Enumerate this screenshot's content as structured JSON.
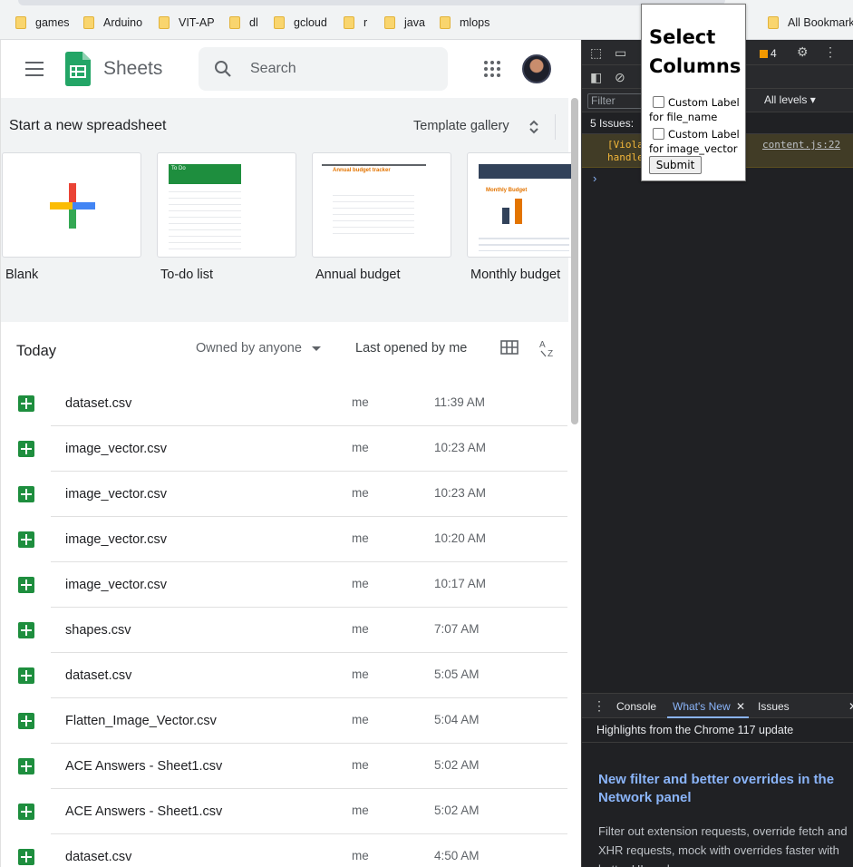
{
  "bookmarks": [
    "games",
    "Arduino",
    "VIT-AP",
    "dl",
    "gcloud",
    "r",
    "java",
    "mlops"
  ],
  "all_bookmarks": "All Bookmarks",
  "app": {
    "name": "Sheets",
    "search_placeholder": "Search"
  },
  "templates": {
    "heading": "Start a new spreadsheet",
    "gallery_label": "Template gallery",
    "items": [
      "Blank",
      "To-do list",
      "Annual budget",
      "Monthly budget"
    ],
    "todo_header": "To Do",
    "annual_header": "Annual budget tracker",
    "monthly_header": "Monthly Budget"
  },
  "filters": {
    "section_title": "Today",
    "owner_filter": "Owned by anyone",
    "sort_label": "Last opened by me"
  },
  "files": [
    {
      "name": "dataset.csv",
      "owner": "me",
      "time": "11:39 AM"
    },
    {
      "name": "image_vector.csv",
      "owner": "me",
      "time": "10:23 AM"
    },
    {
      "name": "image_vector.csv",
      "owner": "me",
      "time": "10:23 AM"
    },
    {
      "name": "image_vector.csv",
      "owner": "me",
      "time": "10:20 AM"
    },
    {
      "name": "image_vector.csv",
      "owner": "me",
      "time": "10:17 AM"
    },
    {
      "name": "shapes.csv",
      "owner": "me",
      "time": "7:07 AM"
    },
    {
      "name": "dataset.csv",
      "owner": "me",
      "time": "5:05 AM"
    },
    {
      "name": "Flatten_Image_Vector.csv",
      "owner": "me",
      "time": "5:04 AM"
    },
    {
      "name": "ACE Answers - Sheet1.csv",
      "owner": "me",
      "time": "5:02 AM"
    },
    {
      "name": "ACE Answers - Sheet1.csv",
      "owner": "me",
      "time": "5:02 AM"
    },
    {
      "name": "dataset.csv",
      "owner": "me",
      "time": "4:50 AM"
    }
  ],
  "devtools": {
    "issue_count_badge": "4",
    "filter_placeholder": "Filter",
    "levels": "All levels",
    "issues_text": "5 Issues:",
    "warning_line1": "[Viola",
    "warning_line2": "handle",
    "warning_source": "content.js:22",
    "prompt": "›",
    "drawer_tabs": [
      "Console",
      "What's New",
      "Issues"
    ],
    "highlights": "Highlights from the Chrome 117 update",
    "whats_new_title": "New filter and better overrides in the Network panel",
    "whats_new_body": "Filter out extension requests, override fetch and XHR requests, mock with overrides faster with better UI, and more."
  },
  "popup": {
    "title": "Select Columns",
    "options": [
      "Custom Label for file_name",
      "Custom Label for image_vector"
    ],
    "submit": "Submit"
  },
  "colors": {
    "sheets_green": "#1e8e3e",
    "devtools_bg": "#202124",
    "link_blue": "#8ab4f8",
    "warning_yellow": "#f2b63a"
  }
}
